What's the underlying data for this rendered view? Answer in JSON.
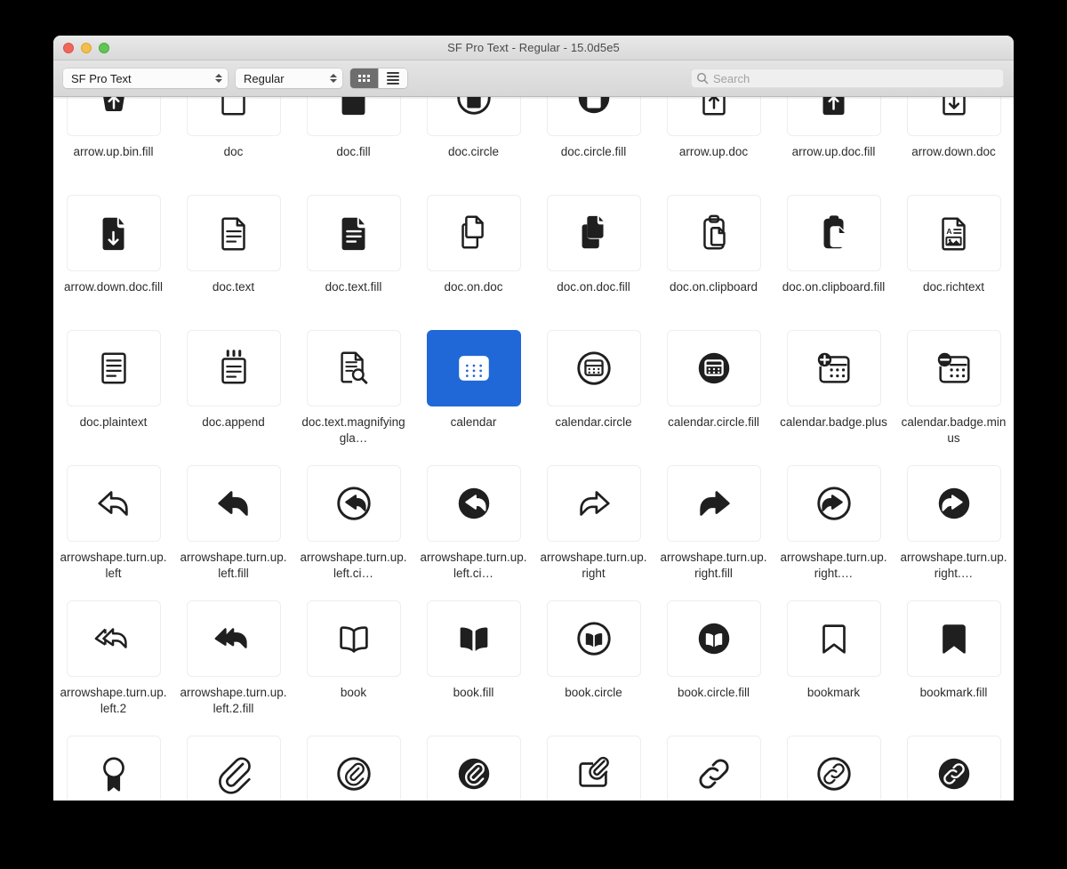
{
  "window": {
    "title": "SF Pro Text - Regular - 15.0d5e5",
    "traffic_lights": [
      "close-red",
      "minimize-yellow",
      "zoom-green"
    ]
  },
  "toolbar": {
    "font_family": "SF Pro Text",
    "font_style": "Regular",
    "view_modes": [
      {
        "name": "grid-view",
        "icon": "grid-icon",
        "active": true
      },
      {
        "name": "list-view",
        "icon": "list-icon",
        "active": false
      }
    ],
    "search": {
      "value": "",
      "placeholder": "Search",
      "icon": "search-icon"
    }
  },
  "grid": {
    "columns": 8,
    "selected": "calendar",
    "rows": [
      {
        "clipped_top": true,
        "cells": [
          {
            "label": "arrow.up.bin.fill",
            "icon": "arrow-up-bin-fill-icon"
          },
          {
            "label": "doc",
            "icon": "doc-icon"
          },
          {
            "label": "doc.fill",
            "icon": "doc-fill-icon"
          },
          {
            "label": "doc.circle",
            "icon": "doc-circle-icon"
          },
          {
            "label": "doc.circle.fill",
            "icon": "doc-circle-fill-icon"
          },
          {
            "label": "arrow.up.doc",
            "icon": "arrow-up-doc-icon"
          },
          {
            "label": "arrow.up.doc.fill",
            "icon": "arrow-up-doc-fill-icon"
          },
          {
            "label": "arrow.down.doc",
            "icon": "arrow-down-doc-icon"
          }
        ]
      },
      {
        "clipped_top": false,
        "cells": [
          {
            "label": "arrow.down.doc.fill",
            "icon": "arrow-down-doc-fill-icon"
          },
          {
            "label": "doc.text",
            "icon": "doc-text-icon"
          },
          {
            "label": "doc.text.fill",
            "icon": "doc-text-fill-icon"
          },
          {
            "label": "doc.on.doc",
            "icon": "doc-on-doc-icon"
          },
          {
            "label": "doc.on.doc.fill",
            "icon": "doc-on-doc-fill-icon"
          },
          {
            "label": "doc.on.clipboard",
            "icon": "doc-on-clipboard-icon"
          },
          {
            "label": "doc.on.clipboard.fill",
            "icon": "doc-on-clipboard-fill-icon"
          },
          {
            "label": "doc.richtext",
            "icon": "doc-richtext-icon"
          }
        ]
      },
      {
        "clipped_top": false,
        "cells": [
          {
            "label": "doc.plaintext",
            "icon": "doc-plaintext-icon"
          },
          {
            "label": "doc.append",
            "icon": "doc-append-icon"
          },
          {
            "label": "doc.text.magnifyinggla…",
            "icon": "doc-text-magnifyingglass-icon"
          },
          {
            "label": "calendar",
            "icon": "calendar-icon",
            "selected": true
          },
          {
            "label": "calendar.circle",
            "icon": "calendar-circle-icon"
          },
          {
            "label": "calendar.circle.fill",
            "icon": "calendar-circle-fill-icon"
          },
          {
            "label": "calendar.badge.plus",
            "icon": "calendar-badge-plus-icon"
          },
          {
            "label": "calendar.badge.minus",
            "icon": "calendar-badge-minus-icon"
          }
        ]
      },
      {
        "clipped_top": false,
        "cells": [
          {
            "label": "arrowshape.turn.up.left",
            "icon": "arrowshape-turn-up-left-icon"
          },
          {
            "label": "arrowshape.turn.up.left.fill",
            "icon": "arrowshape-turn-up-left-fill-icon"
          },
          {
            "label": "arrowshape.turn.up.left.ci…",
            "icon": "arrowshape-turn-up-left-circle-icon"
          },
          {
            "label": "arrowshape.turn.up.left.ci…",
            "icon": "arrowshape-turn-up-left-circle-fill-icon"
          },
          {
            "label": "arrowshape.turn.up.right",
            "icon": "arrowshape-turn-up-right-icon"
          },
          {
            "label": "arrowshape.turn.up.right.fill",
            "icon": "arrowshape-turn-up-right-fill-icon"
          },
          {
            "label": "arrowshape.turn.up.right.…",
            "icon": "arrowshape-turn-up-right-circle-icon"
          },
          {
            "label": "arrowshape.turn.up.right.…",
            "icon": "arrowshape-turn-up-right-circle-fill-icon"
          }
        ]
      },
      {
        "clipped_top": false,
        "cells": [
          {
            "label": "arrowshape.turn.up.left.2",
            "icon": "arrowshape-turn-up-left-2-icon"
          },
          {
            "label": "arrowshape.turn.up.left.2.fill",
            "icon": "arrowshape-turn-up-left-2-fill-icon"
          },
          {
            "label": "book",
            "icon": "book-icon"
          },
          {
            "label": "book.fill",
            "icon": "book-fill-icon"
          },
          {
            "label": "book.circle",
            "icon": "book-circle-icon"
          },
          {
            "label": "book.circle.fill",
            "icon": "book-circle-fill-icon"
          },
          {
            "label": "bookmark",
            "icon": "bookmark-icon"
          },
          {
            "label": "bookmark.fill",
            "icon": "bookmark-fill-icon"
          }
        ]
      },
      {
        "clipped_bottom": true,
        "cells": [
          {
            "label": "",
            "icon": "rosette-icon"
          },
          {
            "label": "",
            "icon": "paperclip-icon"
          },
          {
            "label": "",
            "icon": "paperclip-circle-icon"
          },
          {
            "label": "",
            "icon": "paperclip-circle-fill-icon"
          },
          {
            "label": "",
            "icon": "rectangle-and-paperclip-icon"
          },
          {
            "label": "",
            "icon": "link-icon"
          },
          {
            "label": "",
            "icon": "link-circle-icon"
          },
          {
            "label": "",
            "icon": "link-circle-fill-icon"
          }
        ]
      }
    ]
  },
  "colors": {
    "selection_blue": "#2068d8",
    "glyph_black": "#1f1f1f",
    "tile_border": "#eeeeee",
    "canvas_bg": "#ffffff"
  }
}
